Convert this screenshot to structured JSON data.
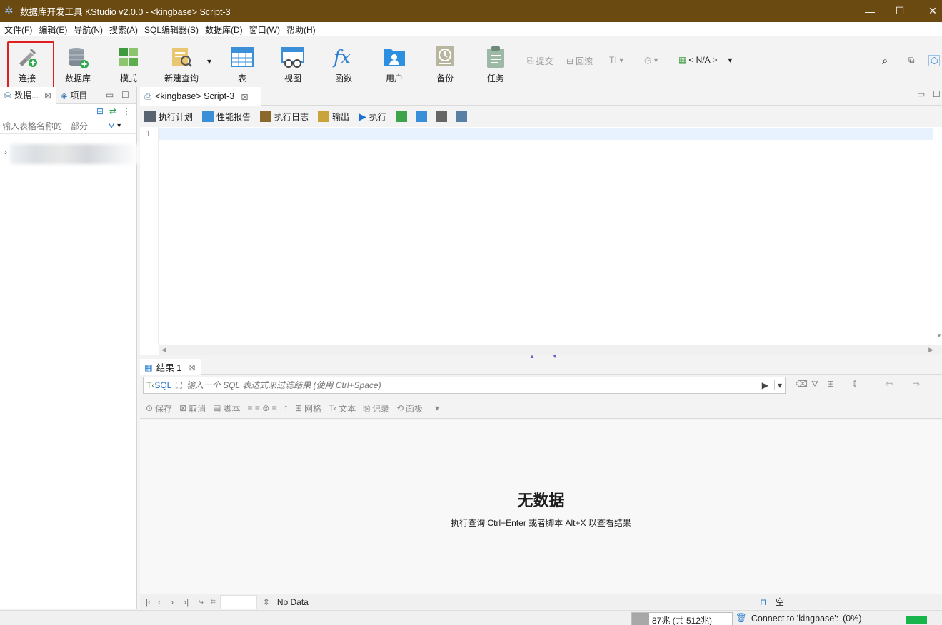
{
  "window": {
    "title": "数据库开发工具 KStudio v2.0.0 - <kingbase> Script-3",
    "minimize": "—",
    "maximize": "☐",
    "close": "✕"
  },
  "menu": [
    "文件(F)",
    "编辑(E)",
    "导航(N)",
    "搜索(A)",
    "SQL编辑器(S)",
    "数据库(D)",
    "窗口(W)",
    "帮助(H)"
  ],
  "toolbar": {
    "connect": "连接",
    "database": "数据库",
    "schema": "模式",
    "new_query": "新建查询",
    "table": "表",
    "view": "视图",
    "function": "函数",
    "user": "用户",
    "backup": "备份",
    "task": "任务",
    "commit": "提交",
    "rollback": "回滚",
    "schema_selector": "< N/A >"
  },
  "left_panel": {
    "tab_db": "数据...",
    "tab_project": "项目",
    "filter_placeholder": "输入表格名称的一部分"
  },
  "editor": {
    "tab_label": "<kingbase> Script-3",
    "toolbar": {
      "exec_plan": "执行计划",
      "perf_report": "性能报告",
      "exec_log": "执行日志",
      "output": "输出",
      "execute": "执行"
    },
    "line_number": "1"
  },
  "results": {
    "tab_label": "结果 1",
    "sql_label": "SQL",
    "filter_placeholder": "输入一个 SQL 表达式来过滤结果 (使用 Ctrl+Space)",
    "actions": {
      "save": "保存",
      "cancel": "取消",
      "script": "脚本",
      "grid": "网格",
      "text": "文本",
      "record": "记录",
      "panel": "面板"
    },
    "empty_title": "无数据",
    "empty_hint": "执行查询 Ctrl+Enter 或者脚本 Alt+X 以查看结果",
    "footer_status": "No Data",
    "footer_right": "空"
  },
  "status_bar": {
    "heap": "87兆 (共 512兆)",
    "heap_used_fraction": 0.17,
    "connection": "Connect to 'kingbase':",
    "progress": "(0%)"
  },
  "colors": {
    "titlebar": "#6b4a12",
    "highlight": "#e02020",
    "progress": "#17b54a"
  }
}
